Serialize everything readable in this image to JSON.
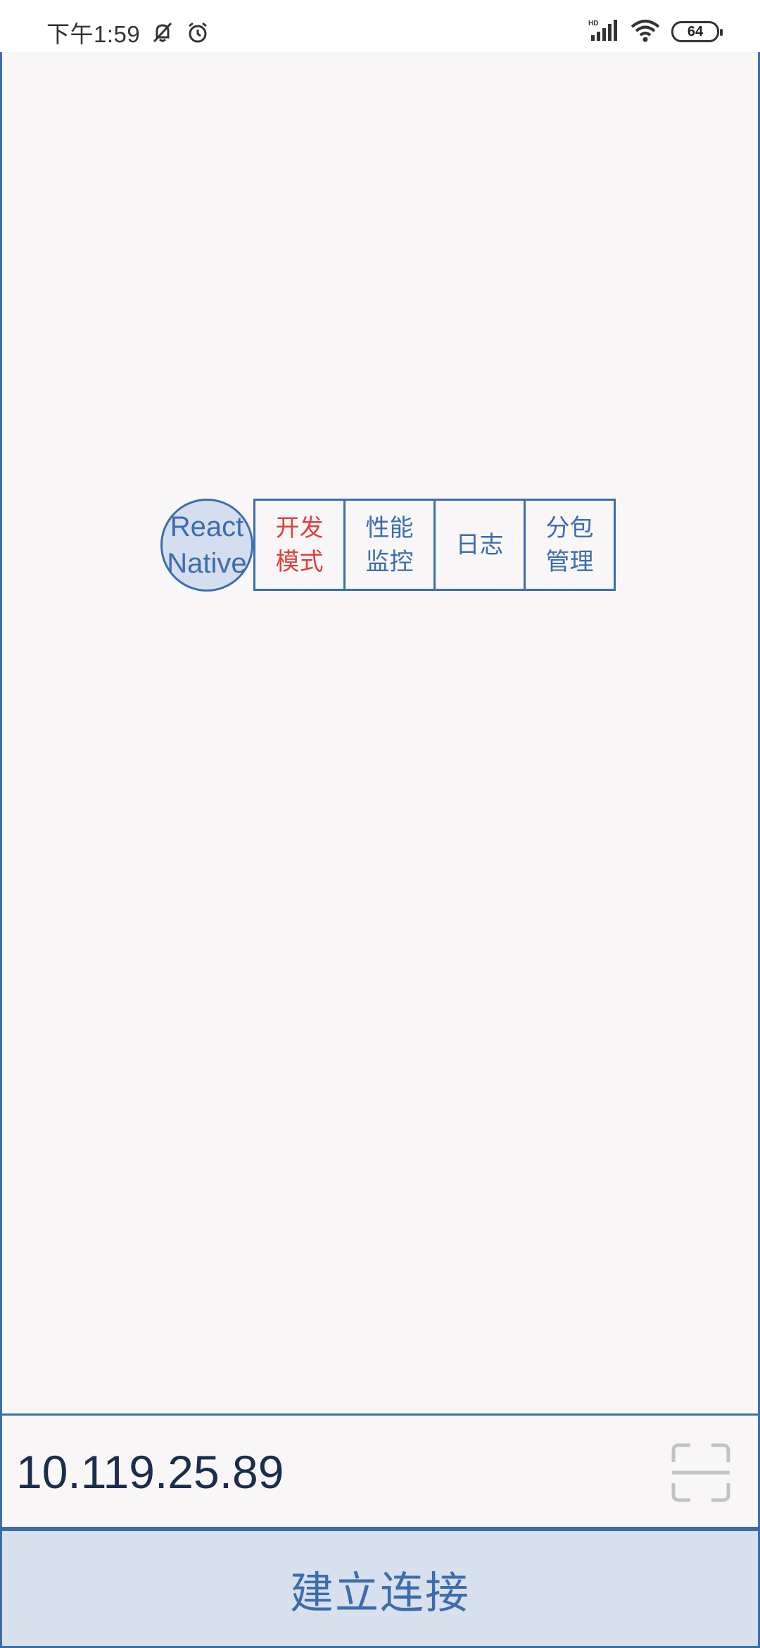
{
  "status_bar": {
    "time": "下午1:59",
    "icons": [
      "mute-bell-icon",
      "alarm-clock-icon",
      "signal-hd-icon",
      "wifi-icon"
    ],
    "battery": "64"
  },
  "floating_menu": {
    "badge": "React\nNative",
    "items": [
      {
        "label": "开发\n模式",
        "active": true
      },
      {
        "label": "性能\n监控",
        "active": false
      },
      {
        "label": "日志",
        "active": false
      },
      {
        "label": "分包\n管理",
        "active": false
      }
    ]
  },
  "address": {
    "value": "10.119.25.89",
    "scan_icon": "scan-qr-icon"
  },
  "connect_button": {
    "label": "建立连接"
  },
  "colors": {
    "accent": "#3c6dad",
    "active": "#e0403f",
    "background": "#f8f6f7",
    "button_bg": "#d9e0ed"
  }
}
